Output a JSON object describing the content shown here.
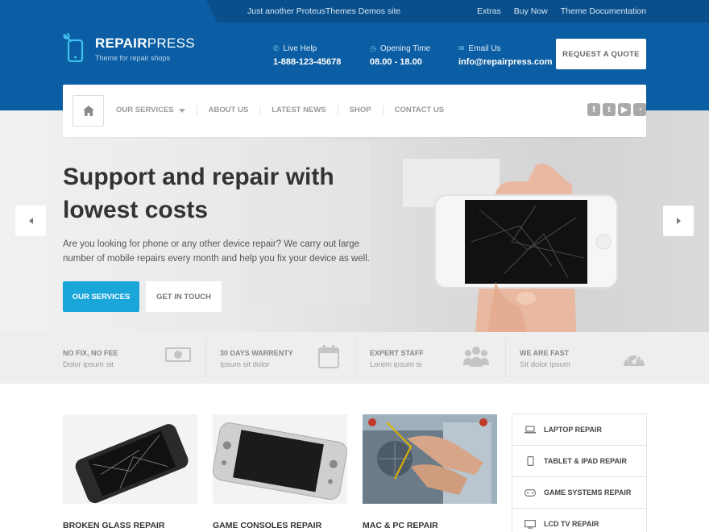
{
  "topbar": {
    "tagline": "Just another ProteusThemes Demos site",
    "links": [
      "Extras",
      "Buy Now",
      "Theme Documentation"
    ]
  },
  "logo": {
    "title_bold": "REPAIR",
    "title_thin": "PRESS",
    "subtitle": "Theme for repair shops"
  },
  "contacts": [
    {
      "label": "Live Help",
      "value": "1-888-123-45678",
      "icon": "phone-icon"
    },
    {
      "label": "Opening Time",
      "value": "08.00 - 18.00",
      "icon": "clock-icon"
    },
    {
      "label": "Email Us",
      "value": "info@repairpress.com",
      "icon": "chat-icon"
    }
  ],
  "quote_button": "REQUEST A QUOTE",
  "nav": {
    "items": [
      "OUR SERVICES",
      "ABOUT US",
      "LATEST NEWS",
      "SHOP",
      "CONTACT US"
    ],
    "socials": [
      "facebook-icon",
      "twitter-icon",
      "youtube-icon",
      "rss-icon"
    ]
  },
  "hero": {
    "title_line1": "Support and repair with",
    "title_line2": "lowest costs",
    "text": "Are you looking for phone or any other device repair? We carry out large number of mobile repairs every month and help you fix your device as well.",
    "primary_button": "OUR SERVICES",
    "secondary_button": "GET IN TOUCH"
  },
  "features": [
    {
      "title": "NO FIX, NO FEE",
      "subtitle": "Dolor ipsum sit",
      "icon": "money-icon"
    },
    {
      "title": "30 DAYS WARRENTY",
      "subtitle": "Ipsum sit dolor",
      "icon": "calendar-icon"
    },
    {
      "title": "EXPERT STAFF",
      "subtitle": "Lorem ipsum si",
      "icon": "group-icon"
    },
    {
      "title": "WE ARE FAST",
      "subtitle": "Sit dolor ipsum",
      "icon": "dashboard-icon"
    }
  ],
  "cards": [
    {
      "caption": "BROKEN GLASS REPAIR"
    },
    {
      "caption": "GAME CONSOLES REPAIR"
    },
    {
      "caption": "MAC & PC REPAIR"
    }
  ],
  "sidebar": [
    {
      "label": "LAPTOP REPAIR",
      "icon": "laptop-icon"
    },
    {
      "label": "TABLET & IPAD REPAIR",
      "icon": "tablet-icon"
    },
    {
      "label": "GAME SYSTEMS REPAIR",
      "icon": "gamepad-icon"
    },
    {
      "label": "LCD TV REPAIR",
      "icon": "tv-icon"
    }
  ],
  "colors": {
    "header_blue": "#0b5ea3",
    "accent": "#1ba6d9"
  }
}
